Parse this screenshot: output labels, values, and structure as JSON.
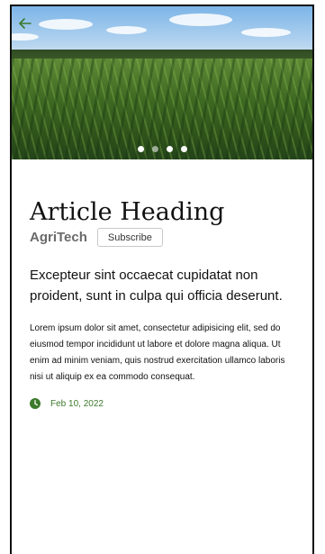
{
  "colors": {
    "accent_green": "#3c7a2b",
    "frame_border": "#111111"
  },
  "header": {
    "back_icon": "arrow-left-icon"
  },
  "hero": {
    "image_subject": "cornfield-photo",
    "carousel_active_index": 0,
    "carousel_dot_count": 4
  },
  "article": {
    "heading": "Article Heading",
    "brand": "AgriTech",
    "subscribe_label": "Subscribe",
    "lead": "Excepteur sint occaecat cupidatat non proident, sunt in culpa qui officia deserunt.",
    "body": "Lorem ipsum dolor sit amet, consectetur adipisicing elit, sed do eiusmod tempor incididunt ut labore et dolore magna aliqua. Ut enim ad minim veniam, quis nostrud exercitation ullamco laboris nisi ut aliquip ex ea commodo consequat.",
    "date": "Feb 10, 2022",
    "date_icon": "clock-icon"
  }
}
